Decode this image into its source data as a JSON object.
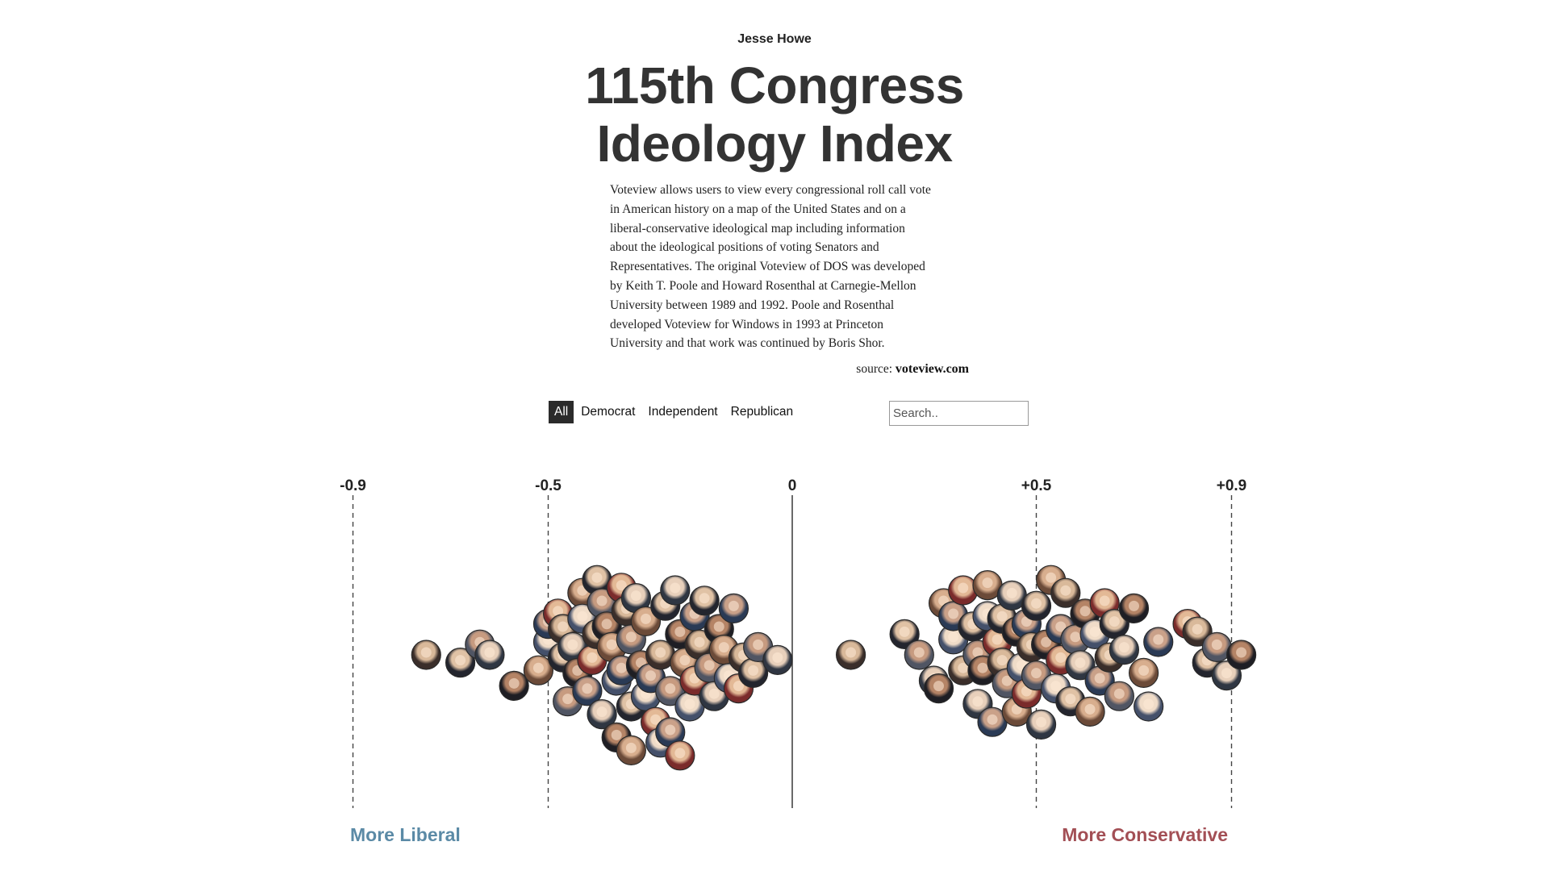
{
  "header": {
    "author": "Jesse Howe",
    "title_line1": "115th Congress",
    "title_line2": "Ideology Index"
  },
  "description_lines": [
    "Voteview allows users to view every congressional roll call vote",
    "in American history on a map of the United States and on a",
    "liberal-conservative ideological map including information",
    "about the ideological positions of voting Senators and",
    "Representatives. The original Voteview of DOS was developed",
    "by Keith T. Poole and Howard Rosenthal at Carnegie-Mellon",
    "University between 1989 and 1992. Poole and Rosenthal",
    "developed Voteview for Windows in 1993 at Princeton",
    "University and that work was continued by Boris Shor."
  ],
  "source": {
    "prefix": "source:",
    "link": "voteview.com"
  },
  "filters": {
    "all": "All",
    "democrat": "Democrat",
    "independent": "Independent",
    "republican": "Republican",
    "active": "All"
  },
  "search": {
    "placeholder": "Search.."
  },
  "labels": {
    "liberal": "More Liberal",
    "conservative": "More Conservative"
  },
  "colors": {
    "liberal": "#5b8aa6",
    "conservative": "#a34f55",
    "axis": "#444444"
  },
  "chart_data": {
    "type": "scatter",
    "description_of_encoding": "",
    "x_axis": {
      "ticks": [
        {
          "value": -0.9,
          "label": "-0.9"
        },
        {
          "value": -0.5,
          "label": "-0.5"
        },
        {
          "value": 0,
          "label": "0"
        },
        {
          "value": 0.5,
          "label": "+0.5"
        },
        {
          "value": 0.9,
          "label": "+0.9"
        }
      ],
      "range": [
        -0.9,
        0.9
      ]
    },
    "series": [
      {
        "party_group": "left",
        "x": [
          -0.75,
          -0.68,
          -0.64,
          -0.62,
          -0.57,
          -0.52,
          -0.5,
          -0.5,
          -0.48,
          -0.47,
          -0.47,
          -0.46,
          -0.45,
          -0.44,
          -0.43,
          -0.43,
          -0.42,
          -0.41,
          -0.4,
          -0.4,
          -0.39,
          -0.39,
          -0.38,
          -0.37,
          -0.36,
          -0.35,
          -0.35,
          -0.34,
          -0.33,
          -0.33,
          -0.32,
          -0.31,
          -0.3,
          -0.3,
          -0.29,
          -0.28,
          -0.27,
          -0.26,
          -0.25,
          -0.24,
          -0.23,
          -0.22,
          -0.21,
          -0.2,
          -0.2,
          -0.19,
          -0.18,
          -0.17,
          -0.16,
          -0.15,
          -0.14,
          -0.13,
          -0.12,
          -0.11,
          -0.1,
          -0.08,
          -0.07,
          -0.03,
          -0.36,
          -0.33,
          -0.27,
          -0.25,
          -0.23
        ],
        "y_slot": [
          0,
          -0.3,
          0.4,
          0.0,
          -1.2,
          -0.6,
          0.5,
          1.2,
          1.6,
          1.0,
          -0.1,
          -1.8,
          0.3,
          -0.7,
          2.4,
          1.4,
          -1.4,
          -0.2,
          0.8,
          2.9,
          2.0,
          -2.3,
          1.1,
          0.3,
          -1.0,
          -0.6,
          2.6,
          1.7,
          -2.0,
          0.6,
          2.2,
          -0.4,
          1.3,
          -1.6,
          -0.9,
          -2.6,
          0.0,
          1.9,
          -1.4,
          2.5,
          0.8,
          -0.3,
          -2.0,
          1.5,
          -1.0,
          0.4,
          2.1,
          -0.5,
          -1.6,
          1.0,
          0.2,
          -0.9,
          1.8,
          -1.3,
          -0.1,
          -0.7,
          0.3,
          -0.2,
          -3.2,
          -3.7,
          -3.4,
          -3.0,
          -3.9
        ]
      },
      {
        "party_group": "right",
        "x": [
          0.12,
          0.23,
          0.26,
          0.29,
          0.3,
          0.31,
          0.33,
          0.33,
          0.35,
          0.35,
          0.37,
          0.38,
          0.38,
          0.39,
          0.4,
          0.4,
          0.41,
          0.42,
          0.43,
          0.43,
          0.44,
          0.45,
          0.46,
          0.46,
          0.47,
          0.48,
          0.48,
          0.49,
          0.5,
          0.5,
          0.51,
          0.52,
          0.53,
          0.54,
          0.55,
          0.55,
          0.56,
          0.57,
          0.58,
          0.59,
          0.6,
          0.61,
          0.62,
          0.63,
          0.64,
          0.65,
          0.66,
          0.67,
          0.68,
          0.7,
          0.72,
          0.73,
          0.75,
          0.81,
          0.83,
          0.85,
          0.87,
          0.89,
          0.92
        ],
        "y_slot": [
          0,
          0.8,
          0,
          -1.0,
          -1.3,
          2.0,
          0.6,
          1.5,
          2.5,
          -0.6,
          1.1,
          0.0,
          -1.9,
          -0.6,
          2.7,
          1.5,
          -2.6,
          0.5,
          -0.3,
          1.4,
          -1.1,
          2.3,
          0.9,
          -2.2,
          -0.5,
          1.2,
          -1.5,
          0.3,
          1.9,
          -0.8,
          -2.7,
          0.4,
          2.9,
          -1.3,
          1.0,
          -0.2,
          2.4,
          -1.8,
          0.6,
          -0.4,
          1.6,
          -2.2,
          0.8,
          -1.0,
          2.0,
          -0.1,
          1.2,
          -1.6,
          0.2,
          1.8,
          -0.7,
          -2.0,
          0.5,
          1.2,
          0.9,
          -0.3,
          0.3,
          -0.8,
          0.0
        ]
      }
    ],
    "annotations": [
      "More Liberal",
      "More Conservative"
    ]
  }
}
